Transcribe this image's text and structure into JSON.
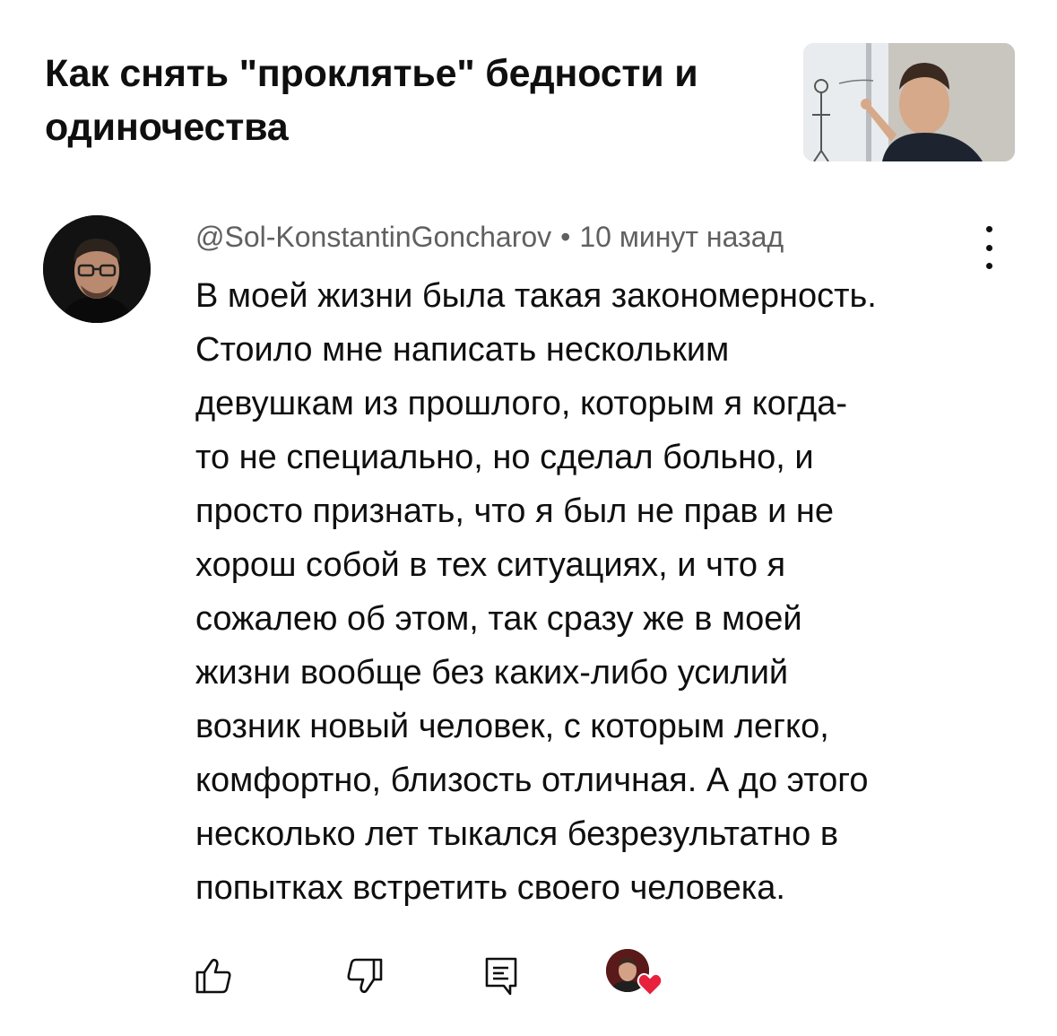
{
  "video": {
    "title": "Как снять \"проклятье\" бедности и одиночества",
    "thumbnail_icon": "video-thumbnail"
  },
  "comment": {
    "author": "@Sol-KonstantinGoncharov",
    "separator": "•",
    "timestamp": "10 минут назад",
    "lines": [
      "В моей жизни была такая закономерность.",
      "Стоило мне написать нескольким",
      "девушкам из прошлого, которым я когда-",
      "то не специально, но сделал больно, и",
      "просто признать, что я был не прав и не",
      "хорош собой в тех ситуациях, и что я",
      "сожалею об этом, так сразу же в моей",
      "жизни вообще без каких-либо усилий",
      "возник новый человек, с которым легко,",
      "комфортно, близость отличная. А до этого",
      "несколько лет тыкался безрезультатно в",
      "попытках встретить своего человека."
    ]
  },
  "actions": {
    "like_icon": "thumbs-up-icon",
    "dislike_icon": "thumbs-down-icon",
    "reply_icon": "reply-comment-icon",
    "creator_heart_icon": "creator-heart-icon"
  },
  "colors": {
    "text_primary": "#0f0f0f",
    "text_secondary": "#606060",
    "heart": "#e8213c"
  }
}
